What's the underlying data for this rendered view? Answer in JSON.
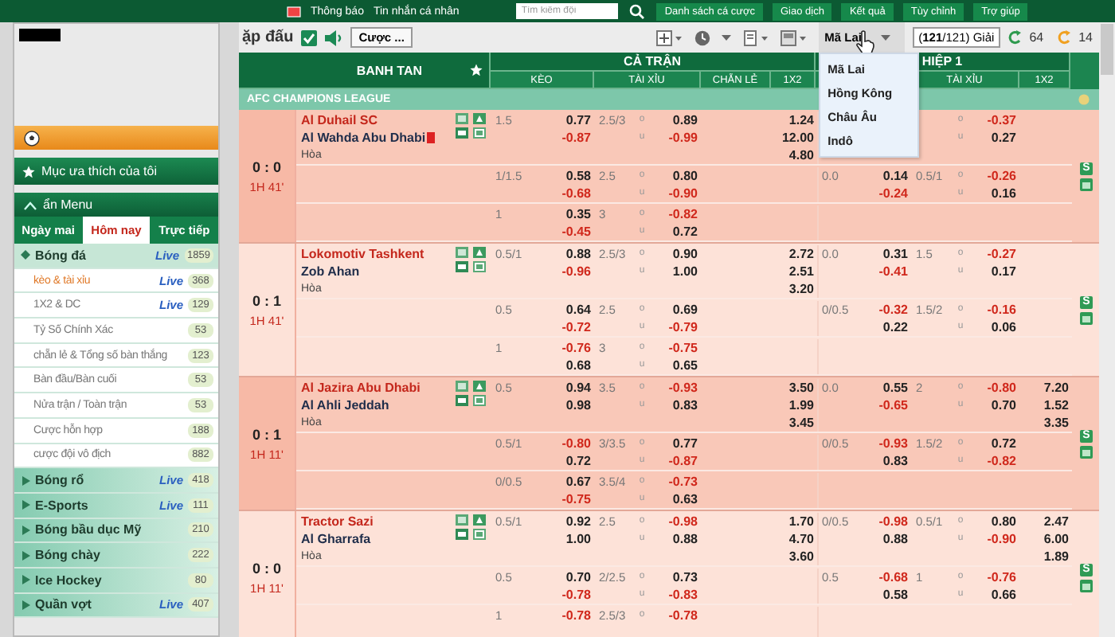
{
  "top_bar": {
    "links": [
      "Thông báo",
      "Tin nhắn cá nhân"
    ],
    "search": {
      "placeholder": "Tìm kiếm đội"
    },
    "buttons": [
      "Danh sách cá cược",
      "Giao dịch",
      "Kết quả",
      "Tùy chỉnh",
      "Trợ giúp"
    ]
  },
  "sidebar": {
    "favorites": "Mục ưa thích của tôi",
    "menu_toggle": "ẩn Menu",
    "tabs": [
      {
        "label": "Ngày mai",
        "selected": false
      },
      {
        "label": "Hôm nay",
        "selected": true
      },
      {
        "label": "Trực tiếp",
        "selected": false
      }
    ],
    "sports": [
      {
        "name": "Bóng đá",
        "live": "Live",
        "count": "1859",
        "expanded": true,
        "children": [
          {
            "name": "kèo & tài xỉu",
            "live": "Live",
            "count": "368",
            "selected": true
          },
          {
            "name": "1X2 & DC",
            "live": "Live",
            "count": "129",
            "selected": false
          },
          {
            "name": "Tỷ Số Chính Xác",
            "count": "53",
            "selected": false
          },
          {
            "name": "chẵn lẻ & Tổng số bàn thắng",
            "count": "123",
            "selected": false
          },
          {
            "name": "Bàn đầu/Bàn cuối",
            "count": "53",
            "selected": false
          },
          {
            "name": "Nửa trận / Toàn trận",
            "count": "53",
            "selected": false
          },
          {
            "name": "Cược hỗn hợp",
            "count": "188",
            "selected": false
          },
          {
            "name": "cược đội vô địch",
            "count": "882",
            "selected": false
          }
        ]
      },
      {
        "name": "Bóng rổ",
        "live": "Live",
        "count": "418",
        "expanded": false
      },
      {
        "name": "E-Sports",
        "live": "Live",
        "count": "111",
        "expanded": false
      },
      {
        "name": "Bóng bầu dục Mỹ",
        "count": "210",
        "expanded": false
      },
      {
        "name": "Bóng chày",
        "count": "222",
        "expanded": false
      },
      {
        "name": "Ice Hockey",
        "count": "80",
        "expanded": false
      },
      {
        "name": "Quần vợt",
        "live": "Live",
        "count": "407",
        "expanded": false
      }
    ]
  },
  "toolbar": {
    "title": "ặp đấu",
    "sound_checked": true,
    "bet_button": "Cược ...",
    "odds_type": {
      "value": "Mã Lai",
      "expanded": true,
      "options": [
        "Mã Lai",
        "Hồng Kông",
        "Châu Âu",
        "Indô"
      ]
    },
    "leagues_button": "(**121**/121) Giải",
    "refresh": [
      {
        "count": "64",
        "color": "#2e9a4e"
      },
      {
        "count": "14",
        "color": "#f0a020"
      }
    ]
  },
  "table": {
    "match_header": "BANH TAN",
    "full_time": "CẢ TRẬN",
    "first_half": "HIỆP 1",
    "full_time_columns": [
      "KÈO",
      "TÀI XỈU",
      "CHẴN LẺ",
      "1X2"
    ],
    "first_half_columns": [
      "TÀI XỈU",
      "1X2"
    ],
    "league": "AFC CHAMPIONS LEAGUE",
    "matches": [
      {
        "score": "0 : 0",
        "time": "1H 41'",
        "home": "Al Duhail SC",
        "away": "Al Wahda Abu Dhabi",
        "away_red_card": true,
        "draw": "Hòa",
        "side_label": "S",
        "lines": [
          {
            "ft_hdp": {
              "line": "1.5",
              "odds": [
                "0.77",
                "-0.87"
              ]
            },
            "ft_ou": {
              "line": "2.5/3",
              "over_mark": "o",
              "over": "0.89",
              "under_mark": "u",
              "under": "-0.99"
            },
            "ft_1x2": [
              "1.24",
              "12.00",
              "4.80"
            ],
            "h1_ou": {
              "over_mark": "o",
              "over": "-0.37",
              "under_mark": "u",
              "under": "0.27"
            }
          },
          {
            "ft_hdp": {
              "line": "1/1.5",
              "odds": [
                "0.58",
                "-0.68"
              ]
            },
            "ft_ou": {
              "line": "2.5",
              "over_mark": "o",
              "over": "0.80",
              "under_mark": "u",
              "under": "-0.90"
            },
            "h1_hdp": {
              "line": "0.0",
              "odds": [
                "0.14",
                "-0.24"
              ]
            },
            "h1_ou": {
              "line": "0.5/1",
              "over_mark": "o",
              "over": "-0.26",
              "under_mark": "u",
              "under": "0.16"
            }
          },
          {
            "ft_hdp": {
              "line": "1",
              "odds": [
                "0.35",
                "-0.45"
              ]
            },
            "ft_ou": {
              "line": "3",
              "over_mark": "o",
              "over": "-0.82",
              "under_mark": "u",
              "under": "0.72"
            }
          }
        ]
      },
      {
        "score": "0 : 1",
        "time": "1H 41'",
        "home": "Lokomotiv Tashkent",
        "away": "Zob Ahan",
        "away_red_card": false,
        "draw": "Hòa",
        "side_label": "S",
        "lines": [
          {
            "ft_hdp": {
              "line": "0.5/1",
              "odds": [
                "0.88",
                "-0.96"
              ]
            },
            "ft_ou": {
              "line": "2.5/3",
              "over_mark": "o",
              "over": "0.90",
              "under_mark": "u",
              "under": "1.00"
            },
            "ft_1x2": [
              "2.72",
              "2.51",
              "3.20"
            ],
            "h1_hdp": {
              "line": "0.0",
              "odds": [
                "0.31",
                "-0.41"
              ]
            },
            "h1_ou": {
              "line": "1.5",
              "over_mark": "o",
              "over": "-0.27",
              "under_mark": "u",
              "under": "0.17"
            }
          },
          {
            "ft_hdp": {
              "line": "0.5",
              "odds": [
                "0.64",
                "-0.72"
              ]
            },
            "ft_ou": {
              "line": "2.5",
              "over_mark": "o",
              "over": "0.69",
              "under_mark": "u",
              "under": "-0.79"
            },
            "h1_hdp": {
              "line": "0/0.5",
              "odds": [
                "-0.32",
                "0.22"
              ]
            },
            "h1_ou": {
              "line": "1.5/2",
              "over_mark": "o",
              "over": "-0.16",
              "under_mark": "u",
              "under": "0.06"
            }
          },
          {
            "ft_hdp": {
              "line": "1",
              "odds": [
                "-0.76",
                "0.68"
              ]
            },
            "ft_ou": {
              "line": "3",
              "over_mark": "o",
              "over": "-0.75",
              "under_mark": "u",
              "under": "0.65"
            }
          }
        ]
      },
      {
        "score": "0 : 1",
        "time": "1H 11'",
        "home": "Al Jazira Abu Dhabi",
        "away": "Al Ahli Jeddah",
        "away_red_card": false,
        "draw": "Hòa",
        "side_label": "S",
        "lines": [
          {
            "ft_hdp": {
              "line": "0.5",
              "odds": [
                "0.94",
                "0.98"
              ]
            },
            "ft_ou": {
              "line": "3.5",
              "over_mark": "o",
              "over": "-0.93",
              "under_mark": "u",
              "under": "0.83"
            },
            "ft_1x2": [
              "3.50",
              "1.99",
              "3.45"
            ],
            "h1_hdp": {
              "line": "0.0",
              "odds": [
                "0.55",
                "-0.65"
              ]
            },
            "h1_ou": {
              "line": "2",
              "over_mark": "o",
              "over": "-0.80",
              "under_mark": "u",
              "under": "0.70"
            },
            "h1_1x2": [
              "7.20",
              "1.52",
              "3.35"
            ]
          },
          {
            "ft_hdp": {
              "line": "0.5/1",
              "odds": [
                "-0.80",
                "0.72"
              ]
            },
            "ft_ou": {
              "line": "3/3.5",
              "over_mark": "o",
              "over": "0.77",
              "under_mark": "u",
              "under": "-0.87"
            },
            "h1_hdp": {
              "line": "0/0.5",
              "odds": [
                "-0.93",
                "0.83"
              ]
            },
            "h1_ou": {
              "line": "1.5/2",
              "over_mark": "o",
              "over": "0.72",
              "under_mark": "u",
              "under": "-0.82"
            }
          },
          {
            "ft_hdp": {
              "line": "0/0.5",
              "odds": [
                "0.67",
                "-0.75"
              ]
            },
            "ft_ou": {
              "line": "3.5/4",
              "over_mark": "o",
              "over": "-0.73",
              "under_mark": "u",
              "under": "0.63"
            }
          }
        ]
      },
      {
        "score": "0 : 0",
        "time": "1H 11'",
        "home": "Tractor Sazi",
        "away": "Al Gharrafa",
        "away_red_card": false,
        "draw": "Hòa",
        "side_label": "S",
        "lines": [
          {
            "ft_hdp": {
              "line": "0.5/1",
              "odds": [
                "0.92",
                "1.00"
              ]
            },
            "ft_ou": {
              "line": "2.5",
              "over_mark": "o",
              "over": "-0.98",
              "under_mark": "u",
              "under": "0.88"
            },
            "ft_1x2": [
              "1.70",
              "4.70",
              "3.60"
            ],
            "h1_hdp": {
              "line": "0/0.5",
              "odds": [
                "-0.98",
                "0.88"
              ]
            },
            "h1_ou": {
              "line": "0.5/1",
              "over_mark": "o",
              "over": "0.80",
              "under_mark": "u",
              "under": "-0.90"
            },
            "h1_1x2": [
              "2.47",
              "6.00",
              "1.89"
            ]
          },
          {
            "ft_hdp": {
              "line": "0.5",
              "odds": [
                "0.70",
                "-0.78"
              ]
            },
            "ft_ou": {
              "line": "2/2.5",
              "over_mark": "o",
              "over": "0.73",
              "under_mark": "u",
              "under": "-0.83"
            },
            "h1_hdp": {
              "line": "0.5",
              "odds": [
                "-0.68",
                "0.58"
              ]
            },
            "h1_ou": {
              "line": "1",
              "over_mark": "o",
              "over": "-0.76",
              "under_mark": "u",
              "under": "0.66"
            }
          },
          {
            "ft_hdp": {
              "line": "1",
              "odds": [
                "-0.78"
              ]
            },
            "ft_ou": {
              "line": "2.5/3",
              "over_mark": "o",
              "over": "-0.78"
            }
          }
        ]
      }
    ]
  }
}
